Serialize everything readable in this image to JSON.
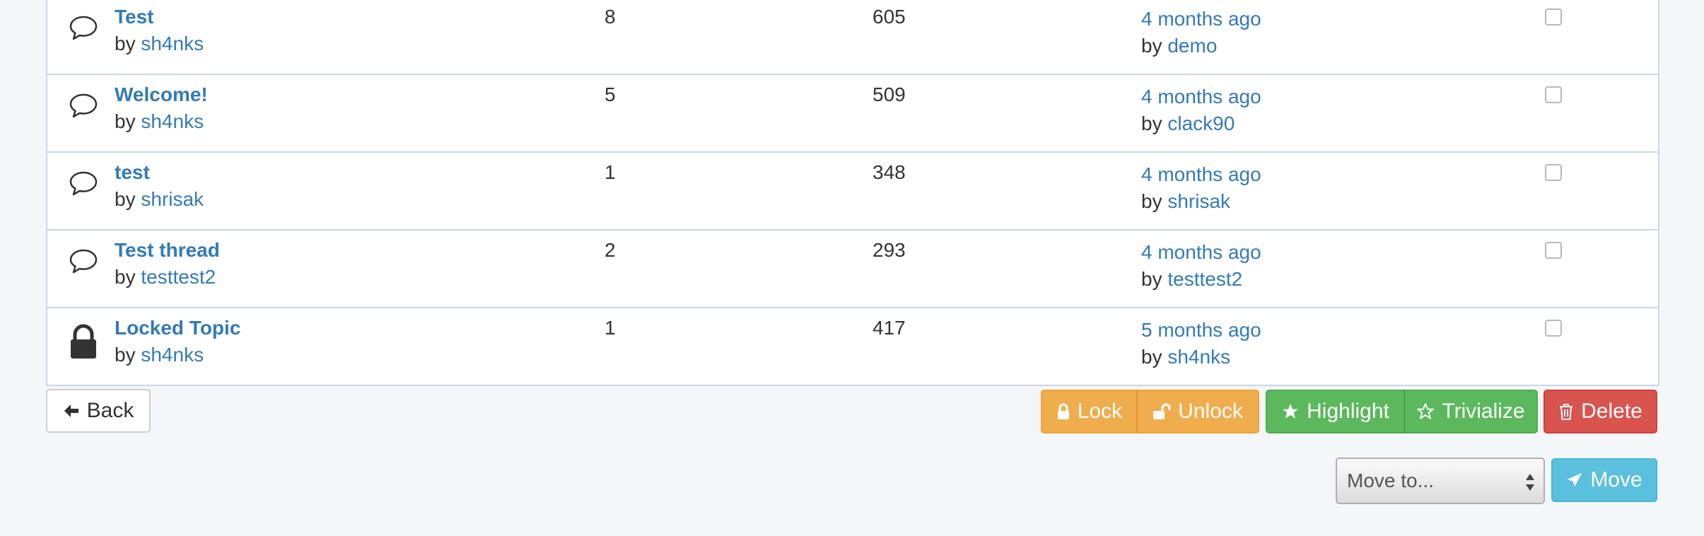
{
  "threads": [
    {
      "title": "Test",
      "by_prefix": "by",
      "author": "sh4nks",
      "replies": "8",
      "views": "605",
      "last_time": "4 months ago",
      "last_author": "demo",
      "icon": "speech-bubble-icon"
    },
    {
      "title": "Welcome!",
      "by_prefix": "by",
      "author": "sh4nks",
      "replies": "5",
      "views": "509",
      "last_time": "4 months ago",
      "last_author": "clack90",
      "icon": "speech-bubble-icon"
    },
    {
      "title": "test",
      "by_prefix": "by",
      "author": "shrisak",
      "replies": "1",
      "views": "348",
      "last_time": "4 months ago",
      "last_author": "shrisak",
      "icon": "speech-bubble-icon"
    },
    {
      "title": "Test thread",
      "by_prefix": "by",
      "author": "testtest2",
      "replies": "2",
      "views": "293",
      "last_time": "4 months ago",
      "last_author": "testtest2",
      "icon": "speech-bubble-icon"
    },
    {
      "title": "Locked Topic",
      "by_prefix": "by",
      "author": "sh4nks",
      "replies": "1",
      "views": "417",
      "last_time": "5 months ago",
      "last_author": "sh4nks",
      "icon": "lock-icon"
    }
  ],
  "actions": {
    "back": "Back",
    "lock": "Lock",
    "unlock": "Unlock",
    "highlight": "Highlight",
    "trivialize": "Trivialize",
    "delete": "Delete",
    "move_select": "Move to...",
    "move": "Move"
  },
  "colors": {
    "link": "#337ab7",
    "warning": "#f0ad4e",
    "success": "#5cb85c",
    "danger": "#d9534f",
    "info": "#5bc0de"
  }
}
